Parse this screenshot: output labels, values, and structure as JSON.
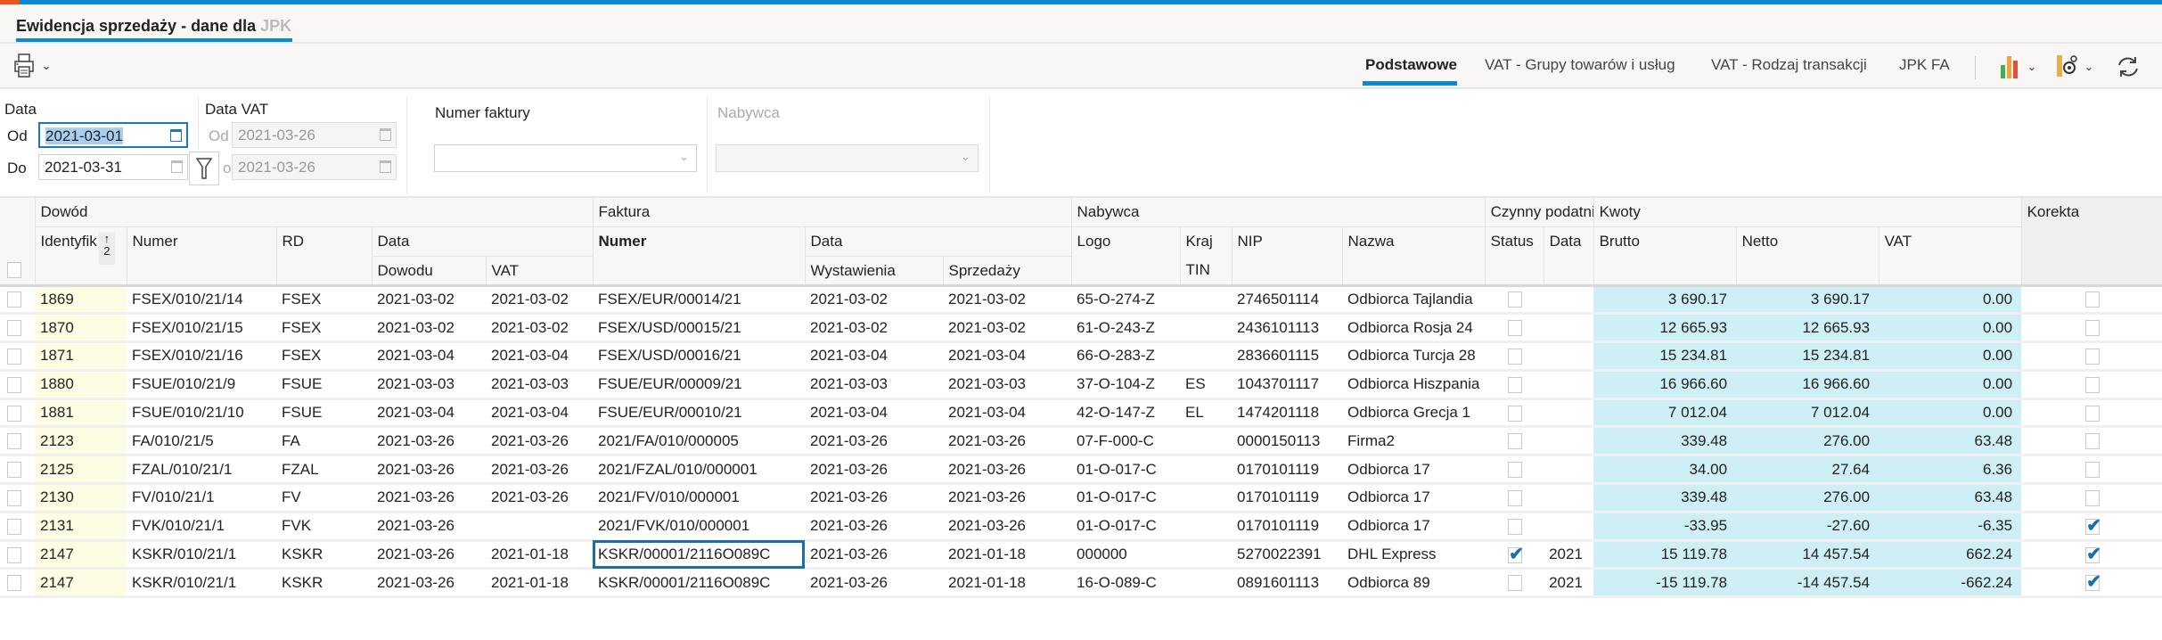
{
  "window": {
    "tab_title": "Ewidencja sprzedaży - dane dla ",
    "tab_title_faded": "JPK V"
  },
  "toolbar": {
    "view_tabs": [
      "Podstawowe",
      "VAT - Grupy towarów i usług",
      "VAT - Rodzaj transakcji",
      "JPK FA"
    ],
    "active_view": "Podstawowe",
    "icons": [
      "printer-icon",
      "chart-icon",
      "gear-icon",
      "refresh-icon"
    ]
  },
  "filters": {
    "data_label": "Data",
    "od_label": "Od",
    "do_label": "Do",
    "data_od": "2021-03-01",
    "data_do": "2021-03-31",
    "data_vat_label": "Data VAT",
    "vat_od_label": "Od",
    "vat_do_label": "o",
    "vat_od": "2021-03-26",
    "vat_do": "2021-03-26",
    "numer_faktury_label": "Numer faktury",
    "numer_faktury_value": "",
    "nabywca_label": "Nabywca",
    "nabywca_value": ""
  },
  "grid": {
    "groups": {
      "dowod": "Dowód",
      "faktura": "Faktura",
      "nabywca": "Nabywca",
      "czynny": "Czynny podatnik",
      "kwoty": "Kwoty",
      "korekta": "Korekta"
    },
    "headers": {
      "identyfik": "Identyfik",
      "sort_order": "2",
      "numer": "Numer",
      "rd": "RD",
      "data": "Data",
      "dowodu": "Dowodu",
      "vat": "VAT",
      "f_numer": "Numer",
      "f_data": "Data",
      "wystawienia": "Wystawienia",
      "sprzedazy": "Sprzedaży",
      "logo": "Logo",
      "kraj": "Kraj",
      "tin": "TIN",
      "nip": "NIP",
      "nazwa": "Nazwa",
      "status": "Status",
      "c_data": "Data",
      "brutto": "Brutto",
      "netto": "Netto",
      "k_vat": "VAT"
    },
    "rows": [
      {
        "id": "1869",
        "numer": "FSEX/010/21/14",
        "rd": "FSEX",
        "dowodu": "2021-03-02",
        "vat": "2021-03-02",
        "f_numer": "FSEX/EUR/00014/21",
        "wyst": "2021-03-02",
        "sprz": "2021-03-02",
        "logo": "65-O-274-Z",
        "kraj": "",
        "nip": "2746501114",
        "nazwa": "Odbiorca Tajlandia",
        "status": false,
        "c_data": "",
        "brutto": "3 690.17",
        "netto": "3 690.17",
        "k_vat": "0.00",
        "korekta": false
      },
      {
        "id": "1870",
        "numer": "FSEX/010/21/15",
        "rd": "FSEX",
        "dowodu": "2021-03-02",
        "vat": "2021-03-02",
        "f_numer": "FSEX/USD/00015/21",
        "wyst": "2021-03-02",
        "sprz": "2021-03-02",
        "logo": "61-O-243-Z",
        "kraj": "",
        "nip": "2436101113",
        "nazwa": "Odbiorca Rosja 24",
        "status": false,
        "c_data": "",
        "brutto": "12 665.93",
        "netto": "12 665.93",
        "k_vat": "0.00",
        "korekta": false
      },
      {
        "id": "1871",
        "numer": "FSEX/010/21/16",
        "rd": "FSEX",
        "dowodu": "2021-03-04",
        "vat": "2021-03-04",
        "f_numer": "FSEX/USD/00016/21",
        "wyst": "2021-03-04",
        "sprz": "2021-03-04",
        "logo": "66-O-283-Z",
        "kraj": "",
        "nip": "2836601115",
        "nazwa": "Odbiorca Turcja 28",
        "status": false,
        "c_data": "",
        "brutto": "15 234.81",
        "netto": "15 234.81",
        "k_vat": "0.00",
        "korekta": false
      },
      {
        "id": "1880",
        "numer": "FSUE/010/21/9",
        "rd": "FSUE",
        "dowodu": "2021-03-03",
        "vat": "2021-03-03",
        "f_numer": "FSUE/EUR/00009/21",
        "wyst": "2021-03-03",
        "sprz": "2021-03-03",
        "logo": "37-O-104-Z",
        "kraj": "ES",
        "nip": "1043701117",
        "nazwa": "Odbiorca Hiszpania",
        "status": false,
        "c_data": "",
        "brutto": "16 966.60",
        "netto": "16 966.60",
        "k_vat": "0.00",
        "korekta": false
      },
      {
        "id": "1881",
        "numer": "FSUE/010/21/10",
        "rd": "FSUE",
        "dowodu": "2021-03-04",
        "vat": "2021-03-04",
        "f_numer": "FSUE/EUR/00010/21",
        "wyst": "2021-03-04",
        "sprz": "2021-03-04",
        "logo": "42-O-147-Z",
        "kraj": "EL",
        "nip": "1474201118",
        "nazwa": "Odbiorca Grecja 1",
        "status": false,
        "c_data": "",
        "brutto": "7 012.04",
        "netto": "7 012.04",
        "k_vat": "0.00",
        "korekta": false
      },
      {
        "id": "2123",
        "numer": "FA/010/21/5",
        "rd": "FA",
        "dowodu": "2021-03-26",
        "vat": "2021-03-26",
        "f_numer": "2021/FA/010/000005",
        "wyst": "2021-03-26",
        "sprz": "2021-03-26",
        "logo": "07-F-000-C",
        "kraj": "",
        "nip": "0000150113",
        "nazwa": "Firma2",
        "status": false,
        "c_data": "",
        "brutto": "339.48",
        "netto": "276.00",
        "k_vat": "63.48",
        "korekta": false
      },
      {
        "id": "2125",
        "numer": "FZAL/010/21/1",
        "rd": "FZAL",
        "dowodu": "2021-03-26",
        "vat": "2021-03-26",
        "f_numer": "2021/FZAL/010/000001",
        "wyst": "2021-03-26",
        "sprz": "2021-03-26",
        "logo": "01-O-017-C",
        "kraj": "",
        "nip": "0170101119",
        "nazwa": "Odbiorca 17",
        "status": false,
        "c_data": "",
        "brutto": "34.00",
        "netto": "27.64",
        "k_vat": "6.36",
        "korekta": false
      },
      {
        "id": "2130",
        "numer": "FV/010/21/1",
        "rd": "FV",
        "dowodu": "2021-03-26",
        "vat": "2021-03-26",
        "f_numer": "2021/FV/010/000001",
        "wyst": "2021-03-26",
        "sprz": "2021-03-26",
        "logo": "01-O-017-C",
        "kraj": "",
        "nip": "0170101119",
        "nazwa": "Odbiorca 17",
        "status": false,
        "c_data": "",
        "brutto": "339.48",
        "netto": "276.00",
        "k_vat": "63.48",
        "korekta": false
      },
      {
        "id": "2131",
        "numer": "FVK/010/21/1",
        "rd": "FVK",
        "dowodu": "2021-03-26",
        "vat": "",
        "f_numer": "2021/FVK/010/000001",
        "wyst": "2021-03-26",
        "sprz": "2021-03-26",
        "logo": "01-O-017-C",
        "kraj": "",
        "nip": "0170101119",
        "nazwa": "Odbiorca 17",
        "status": false,
        "c_data": "",
        "brutto": "-33.95",
        "netto": "-27.60",
        "k_vat": "-6.35",
        "korekta": true
      },
      {
        "id": "2147",
        "numer": "KSKR/010/21/1",
        "rd": "KSKR",
        "dowodu": "2021-03-26",
        "vat": "2021-01-18",
        "f_numer": "KSKR/00001/2116O089C",
        "wyst": "2021-03-26",
        "sprz": "2021-01-18",
        "logo": "000000",
        "kraj": "",
        "nip": "5270022391",
        "nazwa": "DHL Express",
        "status": true,
        "c_data": "2021",
        "brutto": "15 119.78",
        "netto": "14 457.54",
        "k_vat": "662.24",
        "korekta": true,
        "focused": true
      },
      {
        "id": "2147",
        "numer": "KSKR/010/21/1",
        "rd": "KSKR",
        "dowodu": "2021-03-26",
        "vat": "2021-01-18",
        "f_numer": "KSKR/00001/2116O089C",
        "wyst": "2021-03-26",
        "sprz": "2021-01-18",
        "logo": "16-O-089-C",
        "kraj": "",
        "nip": "0891601113",
        "nazwa": "Odbiorca 89",
        "status": false,
        "c_data": "2021",
        "brutto": "-15 119.78",
        "netto": "-14 457.54",
        "k_vat": "-662.24",
        "korekta": true
      }
    ]
  }
}
